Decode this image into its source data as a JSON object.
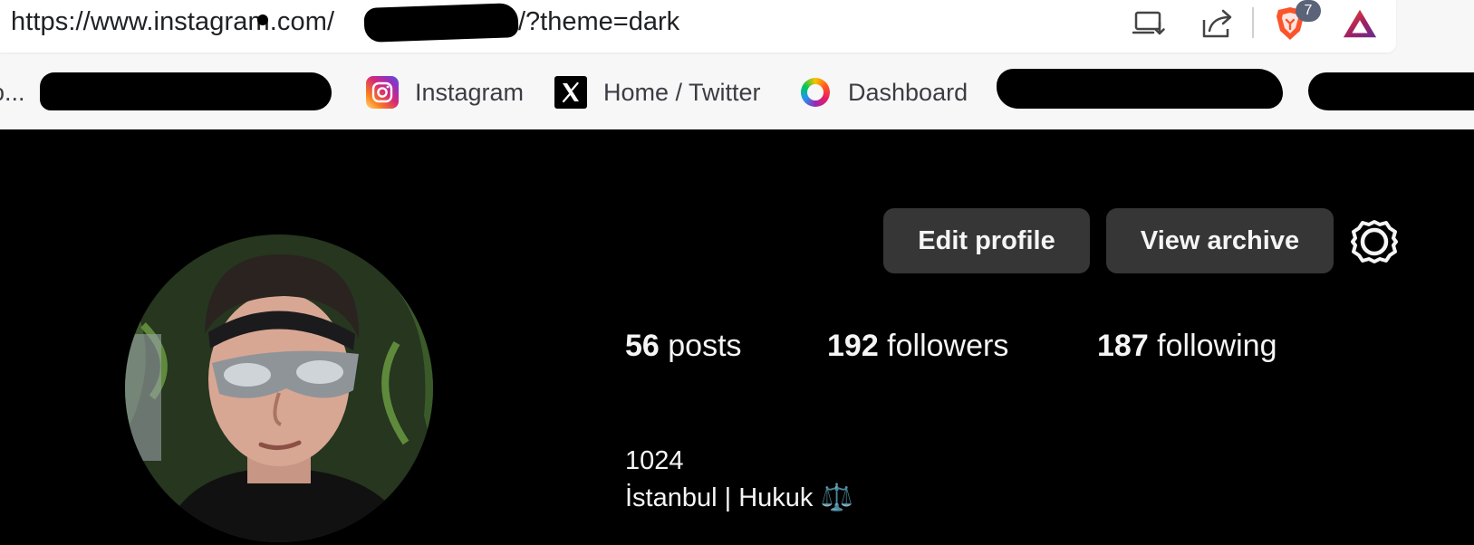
{
  "browser": {
    "url_prefix": "https://www.instagram.com/",
    "url_suffix": "/?theme=dark",
    "toolbar": {
      "install_icon": "install-app-icon",
      "share_icon": "share-icon",
      "shields_icon": "brave-shields-icon",
      "shields_badge": "7",
      "rewards_icon": "brave-rewards-icon"
    },
    "bookmarks": [
      {
        "label": "Instagram",
        "icon": "instagram-icon"
      },
      {
        "label": "Home / Twitter",
        "icon": "x-twitter-icon"
      },
      {
        "label": "Dashboard",
        "icon": "dashboard-ring-icon"
      }
    ],
    "bookmark_overflow_prefix": "o..."
  },
  "profile": {
    "actions": {
      "edit_label": "Edit profile",
      "archive_label": "View archive",
      "settings_icon": "gear-icon"
    },
    "stats": {
      "posts_count": "56",
      "posts_label": " posts",
      "followers_count": "192",
      "followers_label": " followers",
      "following_count": "187",
      "following_label": " following"
    },
    "bio": {
      "line1": "1024",
      "line2": "İstanbul | Hukuk ⚖️"
    }
  },
  "colors": {
    "page_bg": "#000000",
    "button_bg": "#363636",
    "text_primary": "#f5f5f5",
    "chrome_bg": "#f7f7f8"
  }
}
